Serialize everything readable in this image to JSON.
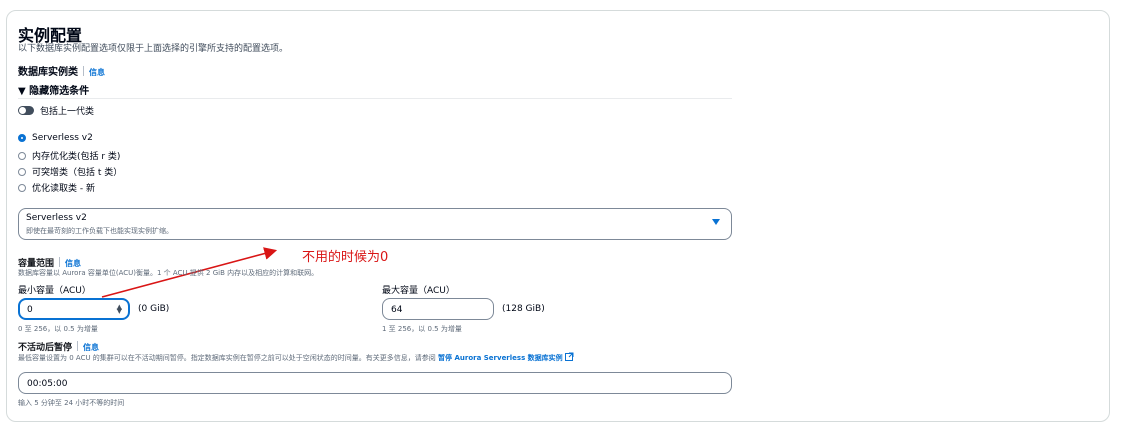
{
  "section": {
    "title": "实例配置",
    "description": "以下数据库实例配置选项仅限于上面选择的引擎所支持的配置选项。",
    "class_label": "数据库实例类",
    "info_label": "信息"
  },
  "filters": {
    "header": "▼ 隐藏筛选条件",
    "include_previous_label": "包括上一代类"
  },
  "radio_options": [
    {
      "label": "Serverless v2",
      "checked": true
    },
    {
      "label": "内存优化类(包括 r 类)",
      "checked": false
    },
    {
      "label": "可突增类（包括 t 类）",
      "checked": false
    },
    {
      "label": "优化读取类 - 新",
      "checked": false
    }
  ],
  "select": {
    "value": "Serverless v2",
    "subtext": "即使在最苛刻的工作负载下也能实现实例扩缩。"
  },
  "annotation": {
    "text": "不用的时候为0",
    "color": "#d91515"
  },
  "capacity": {
    "label": "容量范围",
    "info_label": "信息",
    "description": "数据库容量以 Aurora 容量单位(ACU)衡量。1 个 ACU 提供 2 GiB 内存以及相应的计算和联网。",
    "min": {
      "label": "最小容量（ACU）",
      "value": "0",
      "suffix": "(0 GiB)",
      "hint": "0 至 256，以 0.5 为增量"
    },
    "max": {
      "label": "最大容量（ACU）",
      "value": "64",
      "suffix": "(128 GiB)",
      "hint": "1 至 256，以 0.5 为增量"
    }
  },
  "pause": {
    "label": "不活动后暂停",
    "info_label": "信息",
    "description": "最低容量设置为 0 ACU 的集群可以在不活动期间暂停。指定数据库实例在暂停之前可以处于空闲状态的时间量。有关更多信息，请参阅",
    "link_text": "暂停 Aurora Serverless 数据库实例",
    "value": "00:05:00",
    "hint": "输入 5 分钟至 24 小时不等的时间"
  },
  "colors": {
    "accent": "#0972d3",
    "annotation": "#d91515"
  }
}
